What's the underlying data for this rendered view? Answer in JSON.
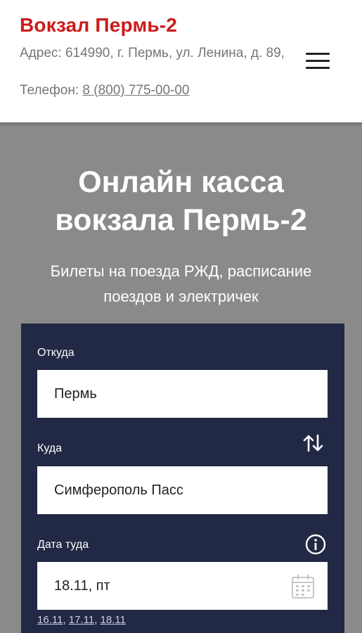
{
  "header": {
    "title": "Вокзал Пермь-2",
    "address": "Адрес: 614990, г. Пермь, ул. Ленина, д. 89,",
    "phone_label": "Телефон: ",
    "phone_number": "8 (800) 775-00-00"
  },
  "hero": {
    "title_line1": "Онлайн касса",
    "title_line2": "вокзала Пермь-2",
    "subtitle_line1": "Билеты на поезда РЖД, расписание",
    "subtitle_line2": "поездов и электричек"
  },
  "search": {
    "from_label": "Откуда",
    "from_value": "Пермь",
    "to_label": "Куда",
    "to_value": "Симферополь Пасс",
    "date_label": "Дата туда",
    "date_value": "18.11, пт",
    "quick_dates": [
      "16.11",
      "17.11",
      "18.11"
    ]
  },
  "colors": {
    "brand_red": "#cc1a1a",
    "panel_bg": "#222944",
    "hero_bg": "#8a8a8a"
  },
  "icons": {
    "menu": "hamburger-icon",
    "swap": "swap-arrows-icon",
    "info": "info-icon",
    "calendar": "calendar-icon"
  }
}
